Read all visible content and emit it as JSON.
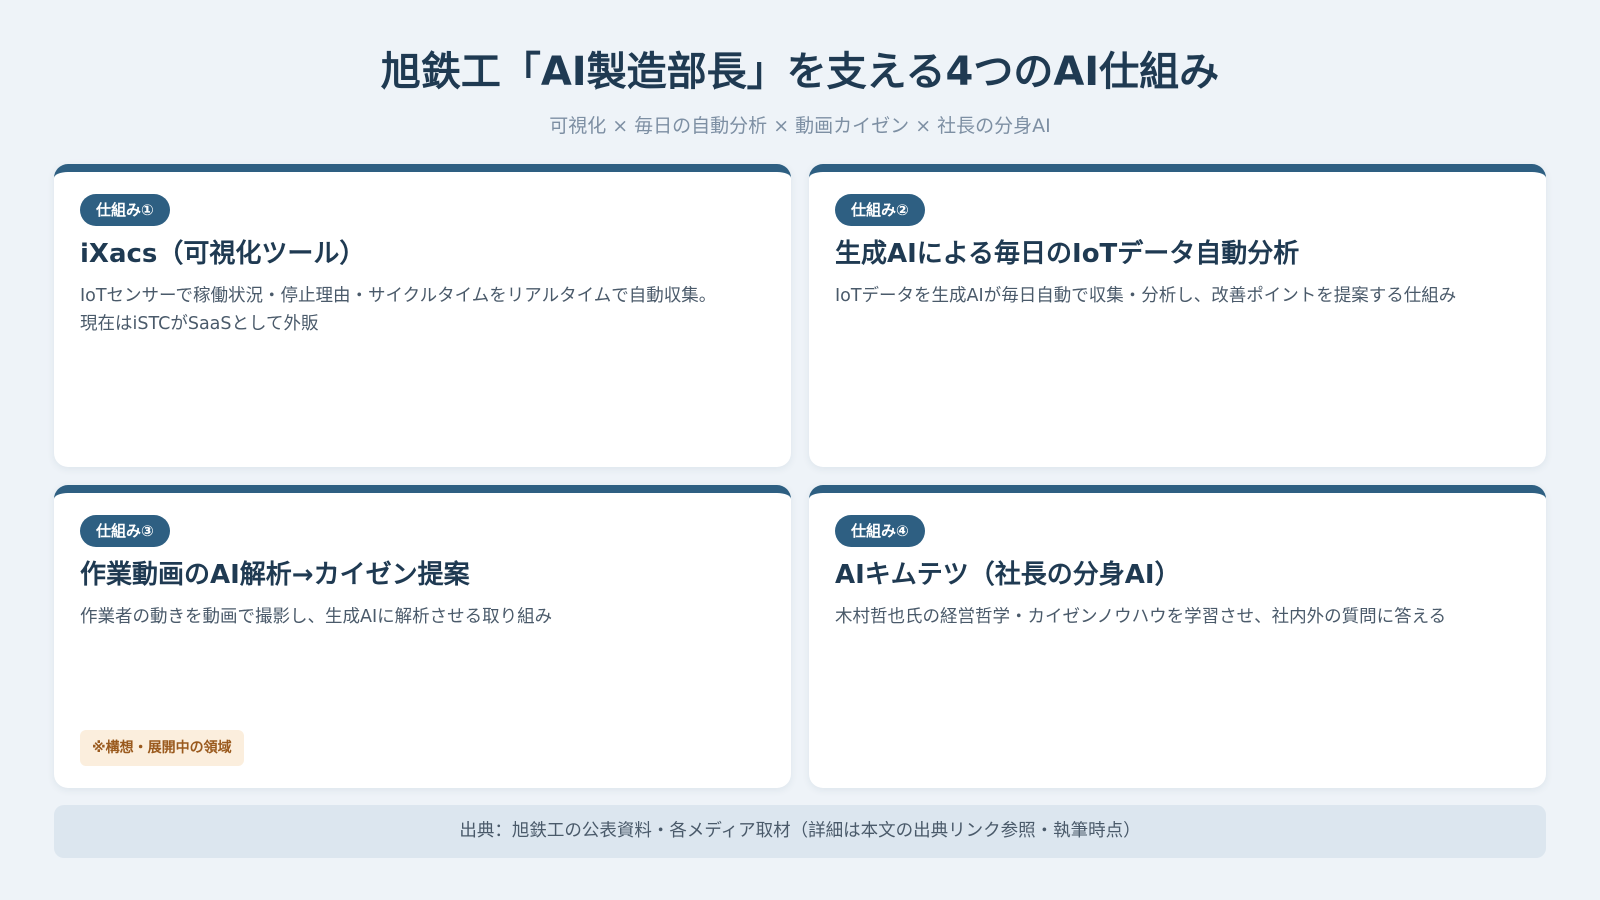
{
  "header": {
    "title": "旭鉄工「AI製造部長」を支える4つのAI仕組み",
    "subtitle": "可視化 × 毎日の自動分析 × 動画カイゼン × 社長の分身AI"
  },
  "cards": [
    {
      "badge": "仕組み①",
      "title": "iXacs（可視化ツール）",
      "desc_line1": "IoTセンサーで稼働状況・停止理由・サイクルタイムをリアルタイムで自動収集。",
      "desc_line2": "現在はiSTCがSaaSとして外販"
    },
    {
      "badge": "仕組み②",
      "title": "生成AIによる毎日のIoTデータ自動分析",
      "desc_line1": "IoTデータを生成AIが毎日自動で収集・分析し、改善ポイントを提案する仕組み"
    },
    {
      "badge": "仕組み③",
      "title": "作業動画のAI解析→カイゼン提案",
      "desc_line1": "作業者の動きを動画で撮影し、生成AIに解析させる取り組み",
      "note": "※構想・展開中の領域"
    },
    {
      "badge": "仕組み④",
      "title": "AIキムテツ（社長の分身AI）",
      "desc_line1": "木村哲也氏の経営哲学・カイゼンノウハウを学習させ、社内外の質問に答える"
    }
  ],
  "footer": {
    "text": "出典：旭鉄工の公表資料・各メディア取材（詳細は本文の出典リンク参照・執筆時点）"
  },
  "colors": {
    "background": "#eef3f8",
    "accent": "#2e5f82",
    "title": "#1f3a52",
    "note_bg": "#fbeedd",
    "note_text": "#9a5a1e"
  }
}
